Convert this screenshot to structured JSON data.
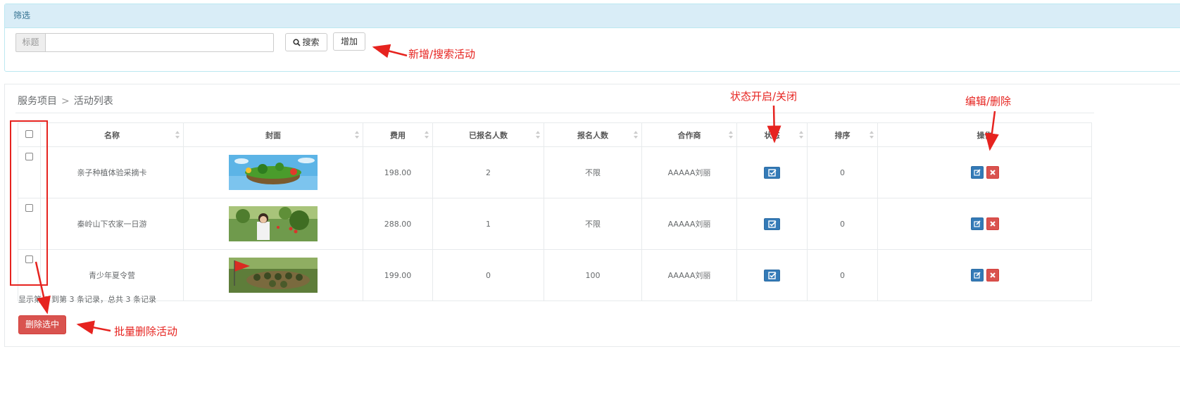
{
  "filter": {
    "heading": "筛选",
    "title_addon": "标题",
    "title_value": "",
    "search_label": "搜索",
    "add_label": "增加"
  },
  "breadcrumb": {
    "section": "服务项目",
    "separator": ">",
    "page": "活动列表"
  },
  "table": {
    "columns": [
      "名称",
      "封面",
      "费用",
      "已报名人数",
      "报名人数",
      "合作商",
      "状态",
      "排序",
      "操作"
    ],
    "rows": [
      {
        "name": "亲子种植体验采摘卡",
        "fee": "198.00",
        "registered": "2",
        "quota": "不限",
        "partner": "AAAAA刘丽",
        "sort": "0"
      },
      {
        "name": "秦岭山下农家一日游",
        "fee": "288.00",
        "registered": "1",
        "quota": "不限",
        "partner": "AAAAA刘丽",
        "sort": "0"
      },
      {
        "name": "青少年夏令营",
        "fee": "199.00",
        "registered": "0",
        "quota": "100",
        "partner": "AAAAA刘丽",
        "sort": "0"
      }
    ]
  },
  "footer": {
    "pager_info": "显示第 1 到第 3 条记录，总共 3 条记录",
    "delete_selected": "删除选中"
  },
  "annotations": {
    "add_search": "新增/搜索活动",
    "status_toggle": "状态开启/关闭",
    "edit_delete": "编辑/删除",
    "batch_delete": "批量删除活动"
  },
  "colors": {
    "annotation": "#e6231f",
    "primary": "#337ab7",
    "danger": "#d9534f",
    "filter_heading_bg": "#d9edf7"
  },
  "icons": [
    "search-icon",
    "check-square-icon",
    "edit-icon",
    "times-icon"
  ]
}
